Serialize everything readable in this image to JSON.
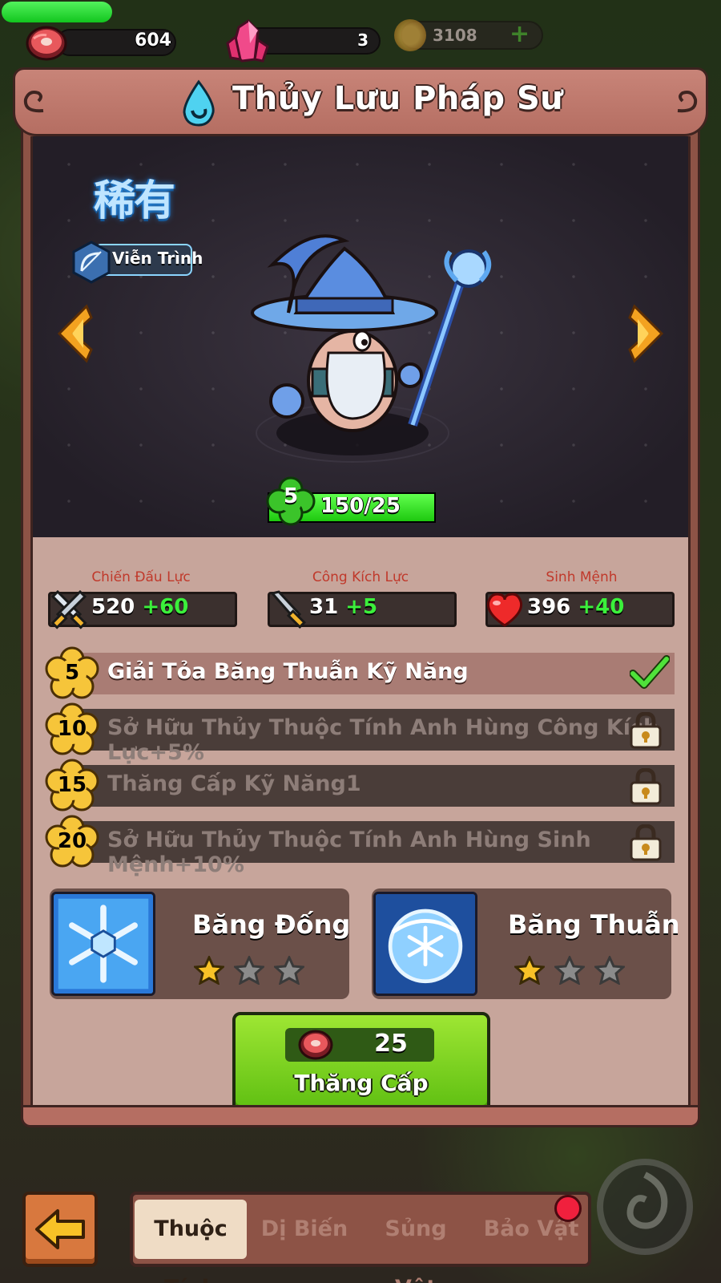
{
  "resources": {
    "meat": "604",
    "gems": "3",
    "coins": "3108",
    "coins_plus": "+"
  },
  "hero": {
    "name": "Thủy Lưu Pháp Sư",
    "rarity": "稀有",
    "type_tag": "Viễn Trình",
    "level": "5",
    "exp_text": "150/25"
  },
  "stats": [
    {
      "label": "Chiến Đấu Lực",
      "value": "520",
      "bonus": "+60",
      "icon": "crossed-swords-icon"
    },
    {
      "label": "Công Kích Lực",
      "value": "31",
      "bonus": "+5",
      "icon": "sword-icon"
    },
    {
      "label": "Sinh Mệnh",
      "value": "396",
      "bonus": "+40",
      "icon": "heart-icon"
    }
  ],
  "unlocks": [
    {
      "level": "5",
      "text": "Giải Tỏa Băng Thuẫn Kỹ Năng",
      "status": "unlocked"
    },
    {
      "level": "10",
      "text": "Sở Hữu Thủy Thuộc Tính Anh Hùng Công Kích Lực+5%",
      "status": "locked"
    },
    {
      "level": "15",
      "text": "Thăng Cấp Kỹ Năng1",
      "status": "locked"
    },
    {
      "level": "20",
      "text": "Sở Hữu Thủy Thuộc Tính Anh Hùng Sinh Mệnh+10%",
      "status": "locked"
    }
  ],
  "skills": [
    {
      "name": "Băng Đống",
      "stars": 1,
      "max_stars": 3
    },
    {
      "name": "Băng Thuẫn",
      "stars": 1,
      "max_stars": 3
    }
  ],
  "upgrade": {
    "cost": "25",
    "label": "Thăng Cấp"
  },
  "tabs": [
    {
      "label": "Thuộc Tính",
      "active": true
    },
    {
      "label": "Dị Biến",
      "active": false
    },
    {
      "label": "Sủng Vật",
      "active": false
    },
    {
      "label": "Bảo Vật",
      "active": false
    }
  ],
  "colors": {
    "panel": "#8d5346",
    "panel_inner": "#c7a59b",
    "bonus_green": "#3bf03b",
    "stat_label_red": "#c0392b",
    "upgrade_green": "#7ed321"
  }
}
